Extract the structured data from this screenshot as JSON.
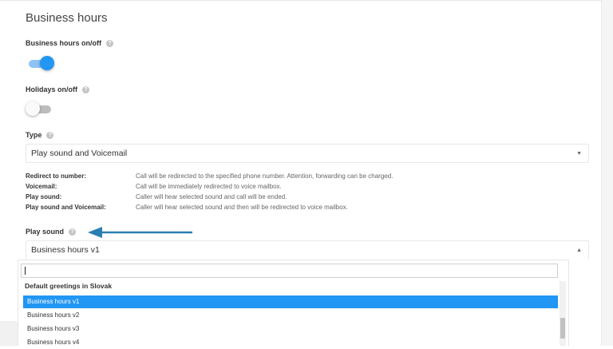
{
  "section": {
    "title": "Business hours"
  },
  "business_hours_toggle": {
    "label": "Business hours on/off",
    "on": true
  },
  "holidays_toggle": {
    "label": "Holidays on/off",
    "on": false
  },
  "type": {
    "label": "Type",
    "selected": "Play sound and Voicemail"
  },
  "descriptions": [
    {
      "key": "Redirect to number:",
      "text": "Call will be redirected to the specified phone number. Attention, forwarding can be charged."
    },
    {
      "key": "Voicemail:",
      "text": "Call will be immediately redirected to voice mailbox."
    },
    {
      "key": "Play sound:",
      "text": "Caller will hear selected sound and call will be ended."
    },
    {
      "key": "Play sound and Voicemail:",
      "text": "Caller will hear selected sound and then will be redirected to voice mailbox."
    }
  ],
  "play_sound": {
    "label": "Play sound",
    "selected": "Business hours v1",
    "search_value": "",
    "group_label": "Default greetings in Slovak",
    "options": [
      "Business hours v1",
      "Business hours v2",
      "Business hours v3",
      "Business hours v4"
    ]
  },
  "colors": {
    "accent": "#2196f3",
    "annotation_arrow": "#2a7fb2"
  },
  "icons": {
    "help": "help-circle-icon",
    "caret_down": "caret-down-icon",
    "caret_up": "caret-up-icon"
  }
}
